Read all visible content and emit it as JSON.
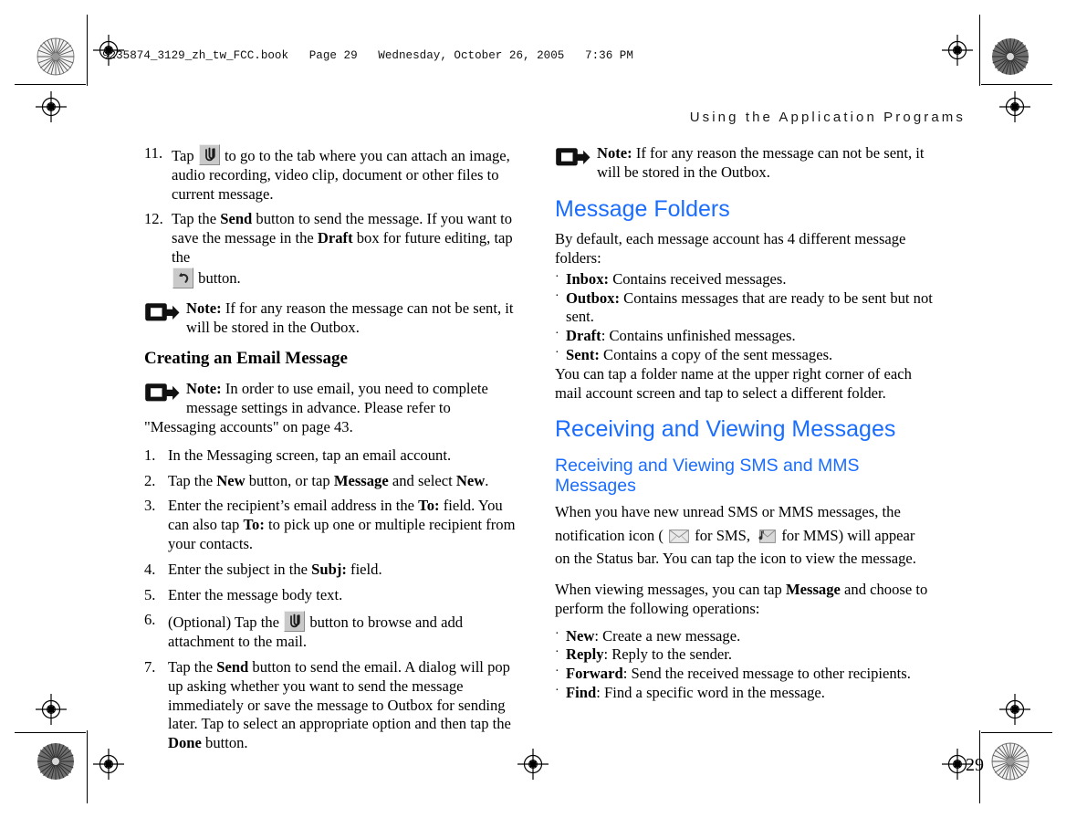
{
  "print_marks": {
    "file_info": "9235874_3129_zh_tw_FCC.book   Page 29   Wednesday, October 26, 2005   7:36 PM"
  },
  "page": {
    "running_head": "Using the Application Programs",
    "page_number": "29"
  },
  "icons": {
    "attach": "paperclip-icon",
    "back": "back-arrow-icon",
    "note": "note-arrow-icon",
    "sms": "envelope-icon",
    "mms": "envelope-music-icon"
  },
  "colors": {
    "heading_blue": "#1a6dff",
    "button_face": "#c9c9c9",
    "text": "#000000"
  },
  "left_column": {
    "steps": [
      {
        "num": "11.",
        "pre": "Tap ",
        "icon": "attach",
        "post": " to go to the tab where you can attach an image, audio recording, video clip, document or other files to current message."
      },
      {
        "num": "12.",
        "pre_a": "Tap the ",
        "bold_a": "Send",
        "mid_a": " button to send the message. If you want to save the message in the ",
        "bold_b": "Draft",
        "mid_b": " box for future editing, tap the ",
        "icon": "back",
        "post": " button."
      }
    ],
    "note_outbox": {
      "label": "Note:",
      "text": " If for any reason the message can not be sent, it will be stored in the Outbox."
    },
    "section_heading": "Creating an Email Message",
    "note_email": {
      "label": "Note:",
      "text": " In order to use email, you need to complete message settings in advance. Please refer to \"Messaging accounts\" on page 43."
    },
    "email_steps": [
      {
        "num": "1.",
        "text": "In the Messaging screen, tap an email account."
      },
      {
        "num": "2.",
        "pre": "Tap the ",
        "b1": "New",
        "mid1": " button, or tap ",
        "b2": "Message",
        "mid2": " and select ",
        "b3": "New",
        "post": "."
      },
      {
        "num": "3.",
        "pre": "Enter the recipient’s email address in the ",
        "b1": "To:",
        "mid1": " field. You can also tap ",
        "b2": "To:",
        "post": " to pick up one or multiple recipient from your contacts."
      },
      {
        "num": "4.",
        "pre": "Enter the subject in the ",
        "b1": "Subj:",
        "post": " field."
      },
      {
        "num": "5.",
        "text": "Enter the message body text."
      },
      {
        "num": "6.",
        "pre": "(Optional) Tap the ",
        "icon": "attach",
        "post": " button to browse and add attachment to the mail."
      },
      {
        "num": "7.",
        "pre": "Tap the ",
        "b1": "Send",
        "mid1": " button to send the email. A dialog will pop up asking whether you want to send the message immediately or save the message to Outbox for sending later. Tap to select an appropriate option and then tap the ",
        "b2": "Done",
        "post": " button."
      }
    ]
  },
  "right_column": {
    "note_outbox": {
      "label": "Note:",
      "text": " If for any reason the message can not be sent, it will be stored in the Outbox."
    },
    "message_folders": {
      "heading": "Message Folders",
      "intro": "By default, each message account has 4 different message folders:",
      "folders": [
        {
          "name": "Inbox:",
          "desc": " Contains received messages."
        },
        {
          "name": "Outbox:",
          "desc": " Contains messages that are ready to be sent but not sent."
        },
        {
          "name": "Draft",
          "desc": ": Contains unfinished messages."
        },
        {
          "name": "Sent:",
          "desc": " Contains a copy of the sent messages."
        }
      ],
      "outro": "You can tap a folder name at the upper right corner of each mail account screen and tap to select a different folder."
    },
    "receiving": {
      "heading": "Receiving and Viewing Messages",
      "subheading": "Receiving and Viewing SMS and MMS Messages",
      "para1_a": "When you have new unread SMS or MMS messages, the notification icon ( ",
      "para1_b": " for SMS, ",
      "para1_c": " for MMS) will appear on the Status bar. You can tap the icon to view the message.",
      "para2_pre": "When viewing messages, you can tap ",
      "para2_bold": "Message",
      "para2_post": " and choose to perform the following operations:",
      "operations": [
        {
          "name": "New",
          "desc": ": Create a new message."
        },
        {
          "name": "Reply",
          "desc": ": Reply to the sender."
        },
        {
          "name": "Forward",
          "desc": ": Send the received message to other recipients."
        },
        {
          "name": "Find",
          "desc": ": Find a specific word in the message."
        }
      ]
    }
  }
}
